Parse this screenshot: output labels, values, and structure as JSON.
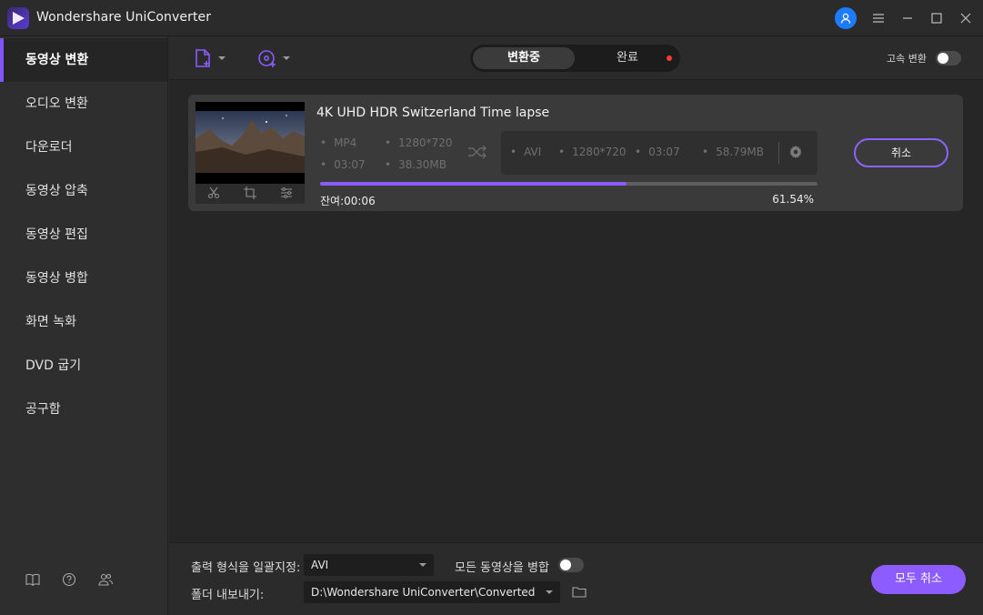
{
  "app": {
    "title": "Wondershare UniConverter"
  },
  "sidebar": {
    "items": [
      {
        "label": "동영상 변환",
        "active": true
      },
      {
        "label": "오디오 변환"
      },
      {
        "label": "다운로더"
      },
      {
        "label": "동영상 압축"
      },
      {
        "label": "동영상 편집"
      },
      {
        "label": "동영상 병합"
      },
      {
        "label": "화면 녹화"
      },
      {
        "label": "DVD 굽기"
      },
      {
        "label": "공구함"
      }
    ],
    "footer_icons": [
      "book-icon",
      "help-icon",
      "users-icon"
    ]
  },
  "toolbar": {
    "tabs": [
      {
        "label": "변환중",
        "active": true
      },
      {
        "label": "완료",
        "has_notification": true
      }
    ],
    "high_speed_label": "고속 변환",
    "high_speed_on": false
  },
  "task": {
    "title": "4K UHD HDR Switzerland Time lapse",
    "source": {
      "format": "MP4",
      "resolution": "1280*720",
      "duration": "03:07",
      "size": "38.30MB"
    },
    "target": {
      "format": "AVI",
      "resolution": "1280*720",
      "duration": "03:07",
      "size": "58.79MB"
    },
    "progress_percent": 61.54,
    "remaining_label": "잔여:00:06",
    "percent_label": "61.54%",
    "cancel_label": "취소"
  },
  "bottom": {
    "output_format_label": "출력 형식을 일괄지정:",
    "output_format_value": "AVI",
    "merge_label": "모든 동영상을 병합",
    "merge_on": false,
    "folder_label": "폴더 내보내기:",
    "folder_value": "D:\\Wondershare UniConverter\\Converted",
    "cancel_all_label": "모두 취소"
  },
  "colors": {
    "accent": "#8a5cff",
    "user_button": "#1d7bff",
    "notification_dot": "#ff3b3b"
  }
}
